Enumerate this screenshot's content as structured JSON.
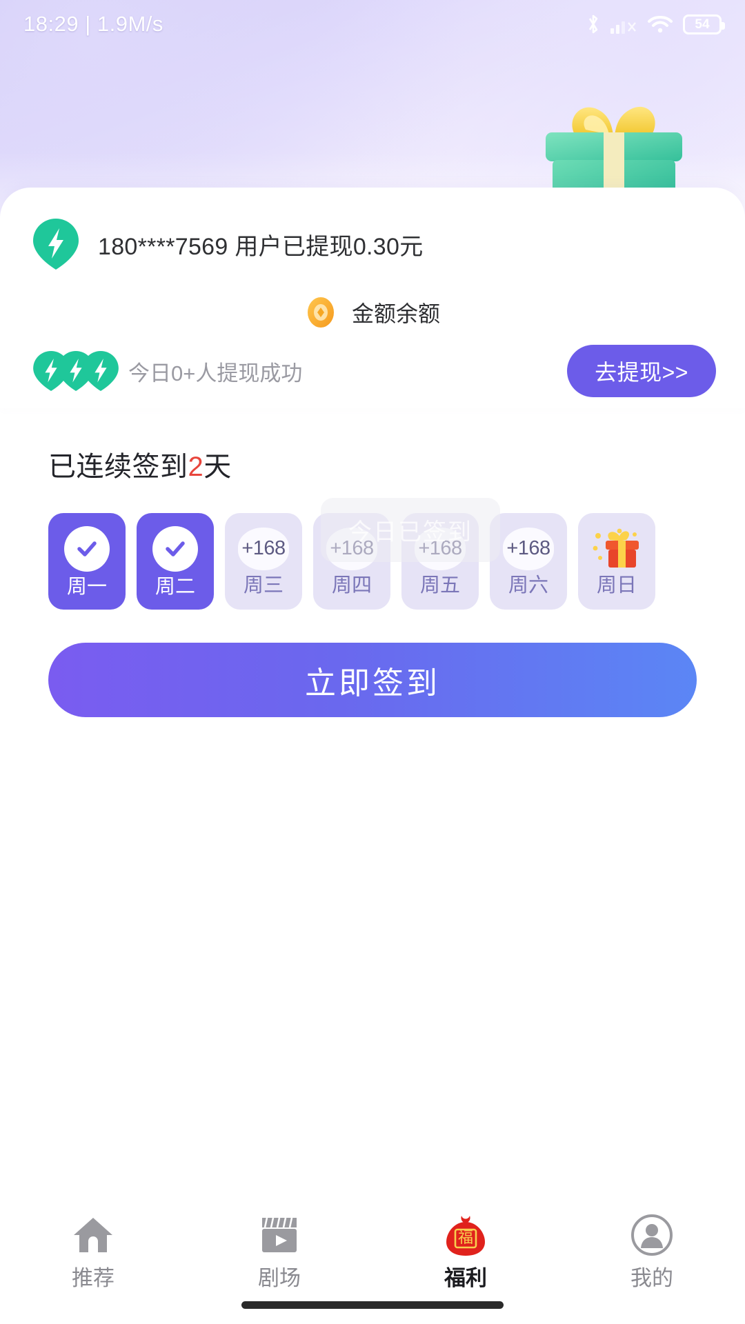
{
  "status_bar": {
    "time": "18:29",
    "separator": "|",
    "network_speed": "1.9M/s",
    "battery_level": "54",
    "icons": [
      "bluetooth-icon",
      "cellular-signal-icon",
      "wifi-icon",
      "battery-icon"
    ]
  },
  "header": {
    "decoration": "green-gift-box-image"
  },
  "info_card": {
    "ticker": {
      "icon": "green-bolt-pin-icon",
      "text": "180****7569 用户已提现0.30元"
    },
    "balance": {
      "icon": "gold-coin-icon",
      "label": "金额余额"
    },
    "today": {
      "icon": "green-bolt-pin-group-icon",
      "text": "今日0+人提现成功"
    },
    "withdraw_button": {
      "label": "去提现>>",
      "color": "#6c5ce9"
    }
  },
  "signin": {
    "streak_prefix": "已连续签到",
    "streak_count": "2",
    "streak_suffix": "天",
    "streak_number_color": "#e8453c",
    "toast_text": "今日已签到",
    "days": [
      {
        "label": "周一",
        "state": "checked",
        "reward": "",
        "icon": "check-icon"
      },
      {
        "label": "周二",
        "state": "checked",
        "reward": "",
        "icon": "check-icon"
      },
      {
        "label": "周三",
        "state": "pending",
        "reward": "+168",
        "icon": ""
      },
      {
        "label": "周四",
        "state": "pending",
        "reward": "+168",
        "icon": ""
      },
      {
        "label": "周五",
        "state": "pending",
        "reward": "+168",
        "icon": ""
      },
      {
        "label": "周六",
        "state": "pending",
        "reward": "+168",
        "icon": ""
      },
      {
        "label": "周日",
        "state": "gift",
        "reward": "",
        "icon": "gift-box-icon"
      }
    ],
    "action_button": {
      "label": "立即签到",
      "gradient_from": "#7a5cf0",
      "gradient_to": "#5b86f5"
    }
  },
  "tabbar": {
    "items": [
      {
        "label": "推荐",
        "icon": "home-icon",
        "active": false
      },
      {
        "label": "剧场",
        "icon": "clapperboard-play-icon",
        "active": false
      },
      {
        "label": "福利",
        "icon": "fortune-bag-icon",
        "active": true
      },
      {
        "label": "我的",
        "icon": "person-circle-icon",
        "active": false
      }
    ]
  }
}
